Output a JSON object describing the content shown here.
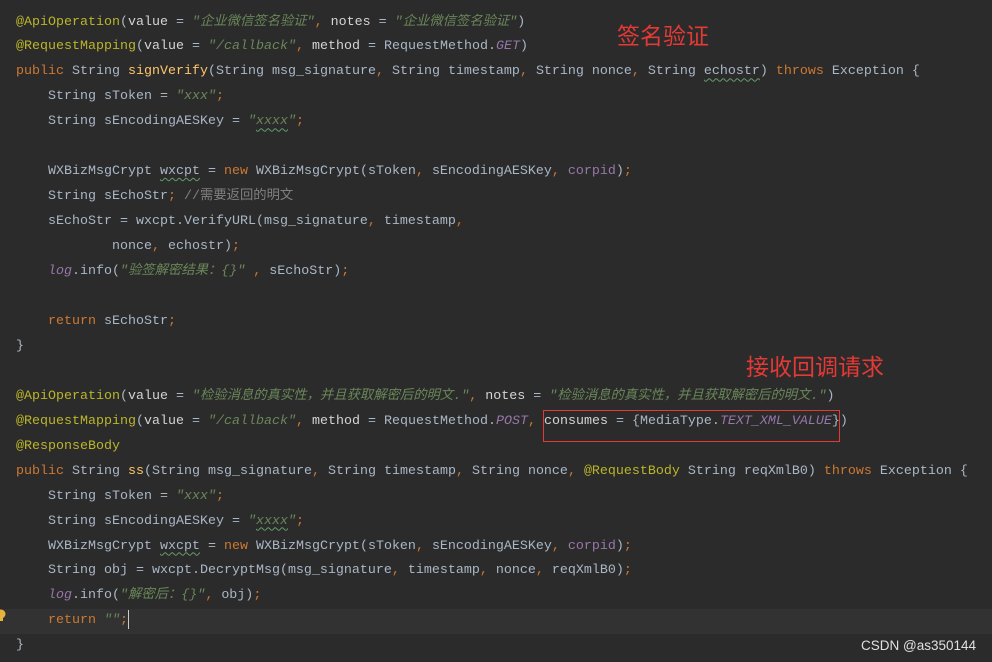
{
  "theme": {
    "background": "#2B2B2B",
    "current_line": "#323232",
    "plain_text": "#A9B7C6",
    "keyword": "#CC7832",
    "string": "#6A8759",
    "annotation": "#BBB529",
    "annotation_attribute": "#D4D4D4",
    "method_declaration": "#FFC66D",
    "constant": "#9876AA",
    "comment": "#808080",
    "typo_underline": "#659C6B",
    "caret": "#CCCCCC",
    "overlay_red": "#E53935",
    "watermark": "#E0E0E0"
  },
  "gutter": {
    "intention_icon": "lightbulb-icon"
  },
  "editor": {
    "lines": [
      {
        "tokens": [
          {
            "a": "@ApiOperation"
          },
          {
            "t": "("
          },
          {
            "p": "value"
          },
          {
            "t": " = "
          },
          {
            "s": "\"企业微信签名验证\""
          },
          {
            "k": ", "
          },
          {
            "p": "notes"
          },
          {
            "t": " = "
          },
          {
            "s": "\"企业微信签名验证\""
          },
          {
            "t": ")"
          }
        ]
      },
      {
        "tokens": [
          {
            "a": "@RequestMapping"
          },
          {
            "t": "("
          },
          {
            "p": "value"
          },
          {
            "t": " = "
          },
          {
            "s": "\"/callback\""
          },
          {
            "k": ", "
          },
          {
            "p": "method"
          },
          {
            "t": " = RequestMethod."
          },
          {
            "c": "GET"
          },
          {
            "t": ")"
          }
        ]
      },
      {
        "tokens": [
          {
            "k": "public "
          },
          {
            "t": "String "
          },
          {
            "m": "signVerify"
          },
          {
            "t": "(String msg_signature"
          },
          {
            "k": ", "
          },
          {
            "t": "String timestamp"
          },
          {
            "k": ", "
          },
          {
            "t": "String nonce"
          },
          {
            "k": ", "
          },
          {
            "t": "String "
          },
          {
            "w": "echostr"
          },
          {
            "t": ") "
          },
          {
            "k": "throws "
          },
          {
            "t": "Exception {"
          }
        ]
      },
      {
        "tokens": [
          {
            "t": "    String sToken = "
          },
          {
            "s": "\"xxx\""
          },
          {
            "k": ";"
          }
        ]
      },
      {
        "tokens": [
          {
            "t": "    String sEncodingAESKey = "
          },
          {
            "s": "\""
          },
          {
            "sw": "xxxx"
          },
          {
            "s": "\""
          },
          {
            "k": ";"
          }
        ]
      },
      {
        "tokens": []
      },
      {
        "tokens": [
          {
            "t": "    WXBizMsgCrypt "
          },
          {
            "w": "wxcpt"
          },
          {
            "t": " = "
          },
          {
            "k": "new "
          },
          {
            "t": "WXBizMsgCrypt(sToken"
          },
          {
            "k": ", "
          },
          {
            "t": "sEncodingAESKey"
          },
          {
            "k": ", "
          },
          {
            "f": "corpid"
          },
          {
            "t": ")"
          },
          {
            "k": ";"
          }
        ]
      },
      {
        "tokens": [
          {
            "t": "    String sEchoStr"
          },
          {
            "k": "; "
          },
          {
            "cm": "//需要返回的明文"
          }
        ]
      },
      {
        "tokens": [
          {
            "t": "    sEchoStr = wxcpt.VerifyURL(msg_signature"
          },
          {
            "k": ", "
          },
          {
            "t": "timestamp"
          },
          {
            "k": ","
          }
        ]
      },
      {
        "tokens": [
          {
            "t": "            nonce"
          },
          {
            "k": ", "
          },
          {
            "t": "echostr)"
          },
          {
            "k": ";"
          }
        ]
      },
      {
        "tokens": [
          {
            "t": "    "
          },
          {
            "c": "log"
          },
          {
            "t": ".info("
          },
          {
            "s": "\"验签解密结果：{}\""
          },
          {
            "t": " "
          },
          {
            "k": ", "
          },
          {
            "t": "sEchoStr)"
          },
          {
            "k": ";"
          }
        ]
      },
      {
        "tokens": []
      },
      {
        "tokens": [
          {
            "t": "    "
          },
          {
            "k": "return "
          },
          {
            "t": "sEchoStr"
          },
          {
            "k": ";"
          }
        ]
      },
      {
        "tokens": [
          {
            "t": "}"
          }
        ]
      },
      {
        "tokens": []
      },
      {
        "tokens": [
          {
            "a": "@ApiOperation"
          },
          {
            "t": "("
          },
          {
            "p": "value"
          },
          {
            "t": " = "
          },
          {
            "s": "\"检验消息的真实性，并且获取解密后的明文.\""
          },
          {
            "k": ", "
          },
          {
            "p": "notes"
          },
          {
            "t": " = "
          },
          {
            "s": "\"检验消息的真实性，并且获取解密后的明文.\""
          },
          {
            "t": ")"
          }
        ]
      },
      {
        "tokens": [
          {
            "a": "@RequestMapping"
          },
          {
            "t": "("
          },
          {
            "p": "value"
          },
          {
            "t": " = "
          },
          {
            "s": "\"/callback\""
          },
          {
            "k": ", "
          },
          {
            "p": "method"
          },
          {
            "t": " = RequestMethod."
          },
          {
            "c": "POST"
          },
          {
            "k": ", "
          },
          {
            "p": "consumes"
          },
          {
            "t": " = {MediaType."
          },
          {
            "c": "TEXT_XML_VALUE"
          },
          {
            "t": "})"
          }
        ]
      },
      {
        "tokens": [
          {
            "a": "@ResponseBody"
          }
        ]
      },
      {
        "tokens": [
          {
            "k": "public "
          },
          {
            "t": "String "
          },
          {
            "m": "ss"
          },
          {
            "t": "(String msg_signature"
          },
          {
            "k": ", "
          },
          {
            "t": "String timestamp"
          },
          {
            "k": ", "
          },
          {
            "t": "String nonce"
          },
          {
            "k": ", "
          },
          {
            "a": "@RequestBody "
          },
          {
            "t": "String reqXmlB0) "
          },
          {
            "k": "throws "
          },
          {
            "t": "Exception {"
          }
        ]
      },
      {
        "tokens": [
          {
            "t": "    String sToken = "
          },
          {
            "s": "\"xxx\""
          },
          {
            "k": ";"
          }
        ]
      },
      {
        "tokens": [
          {
            "t": "    String sEncodingAESKey = "
          },
          {
            "s": "\""
          },
          {
            "sw": "xxxx"
          },
          {
            "s": "\""
          },
          {
            "k": ";"
          }
        ]
      },
      {
        "tokens": [
          {
            "t": "    WXBizMsgCrypt "
          },
          {
            "w": "wxcpt"
          },
          {
            "t": " = "
          },
          {
            "k": "new "
          },
          {
            "t": "WXBizMsgCrypt(sToken"
          },
          {
            "k": ", "
          },
          {
            "t": "sEncodingAESKey"
          },
          {
            "k": ", "
          },
          {
            "f": "corpid"
          },
          {
            "t": ")"
          },
          {
            "k": ";"
          }
        ]
      },
      {
        "tokens": [
          {
            "t": "    String obj = wxcpt.DecryptMsg(msg_signature"
          },
          {
            "k": ", "
          },
          {
            "t": "timestamp"
          },
          {
            "k": ", "
          },
          {
            "t": "nonce"
          },
          {
            "k": ", "
          },
          {
            "t": "reqXmlB0)"
          },
          {
            "k": ";"
          }
        ]
      },
      {
        "tokens": [
          {
            "t": "    "
          },
          {
            "c": "log"
          },
          {
            "t": ".info("
          },
          {
            "s": "\"解密后：{}\""
          },
          {
            "k": ", "
          },
          {
            "t": "obj)"
          },
          {
            "k": ";"
          }
        ]
      },
      {
        "current": true,
        "caret": true,
        "tokens": [
          {
            "t": "    "
          },
          {
            "k": "return "
          },
          {
            "s": "\"\""
          },
          {
            "k": ";"
          }
        ]
      },
      {
        "tokens": [
          {
            "t": "}"
          }
        ]
      }
    ]
  },
  "overlay": {
    "signature_label": "签名验证",
    "callback_label": "接收回调请求",
    "watermark": "CSDN @as350144"
  }
}
